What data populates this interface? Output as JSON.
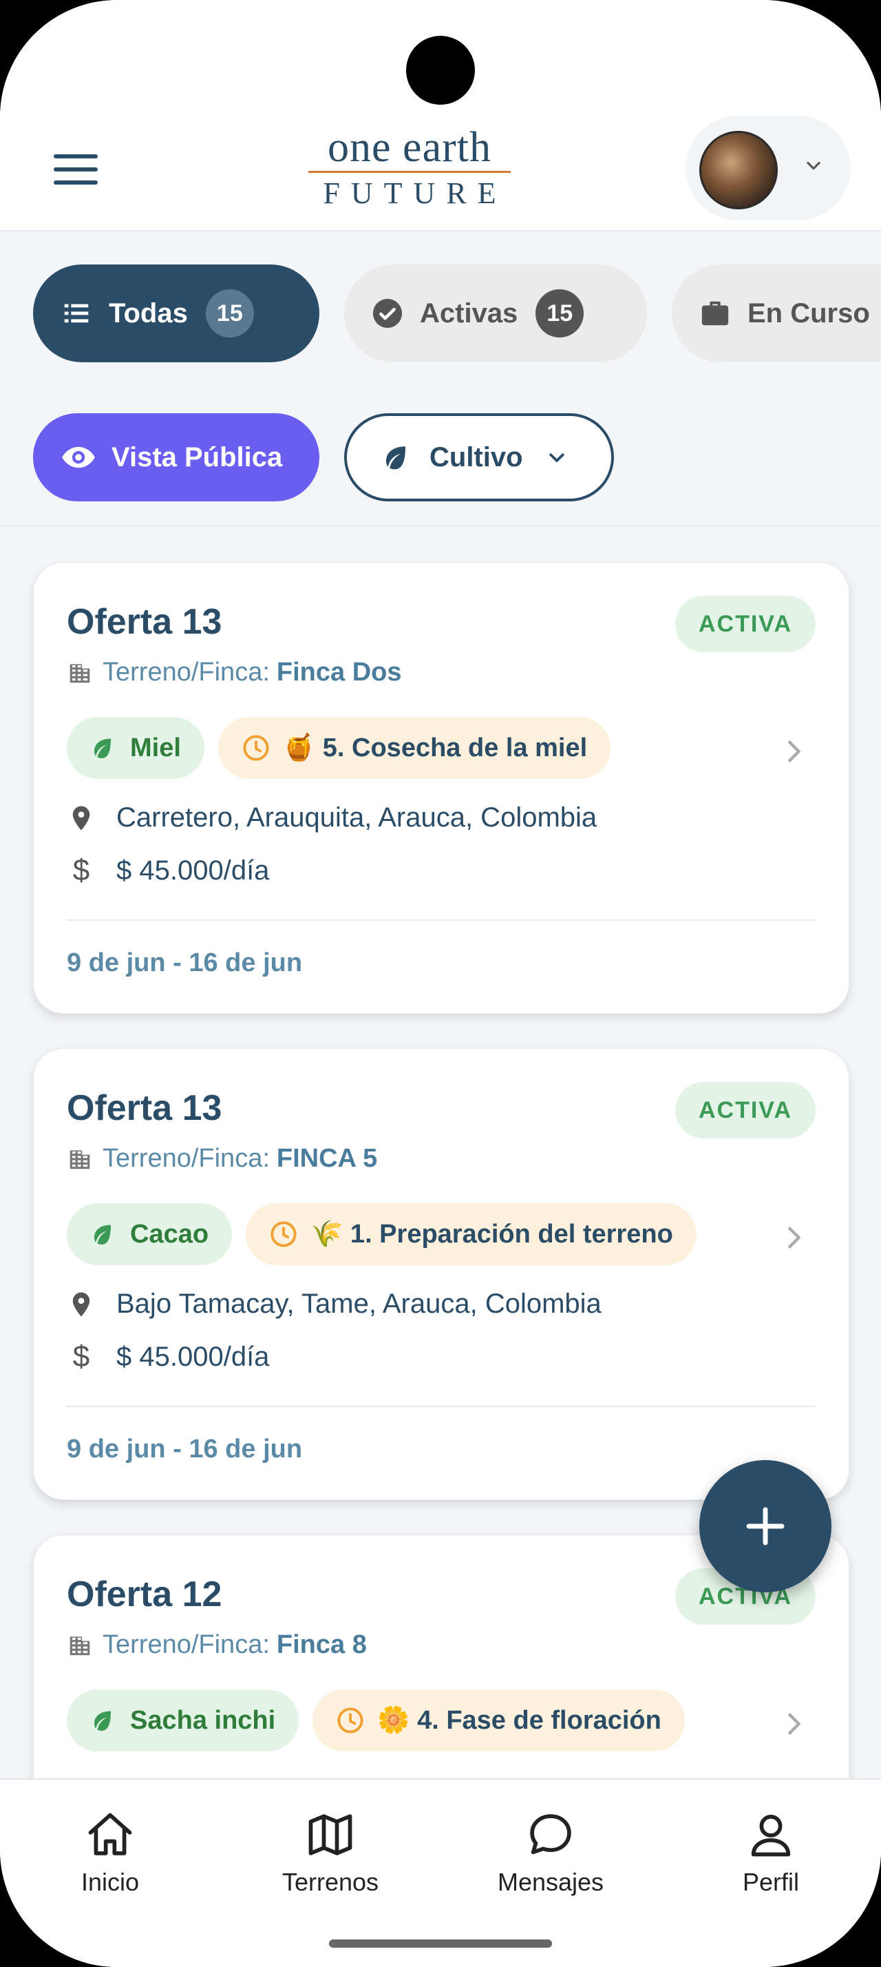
{
  "header": {
    "logo_top": "one earth",
    "logo_bottom": "FUTURE",
    "menu_icon": "hamburger-icon",
    "profile_chevron_icon": "chevron-down-icon"
  },
  "filters": {
    "tabs": [
      {
        "label": "Todas",
        "count": "15",
        "icon": "list-icon",
        "active": true
      },
      {
        "label": "Activas",
        "count": "15",
        "icon": "check-circle-icon",
        "active": false
      },
      {
        "label": "En Curso",
        "icon": "briefcase-icon",
        "active": false
      }
    ],
    "public_view_label": "Vista Pública",
    "crop_filter_label": "Cultivo"
  },
  "offers": [
    {
      "title": "Oferta 13",
      "status": "ACTIVA",
      "terreno_label": "Terreno/Finca:",
      "terreno_name": "Finca Dos",
      "crop": "Miel",
      "stage": "🍯 5. Cosecha de la miel",
      "location": "Carretero, Arauquita, Arauca, Colombia",
      "price": "$ 45.000/día",
      "dates": "9 de jun - 16 de jun"
    },
    {
      "title": "Oferta 13",
      "status": "ACTIVA",
      "terreno_label": "Terreno/Finca:",
      "terreno_name": "FINCA 5",
      "crop": "Cacao",
      "stage": "🌾 1. Preparación del terreno",
      "location": "Bajo Tamacay, Tame, Arauca, Colombia",
      "price": "$ 45.000/día",
      "dates": "9 de jun - 16 de jun"
    },
    {
      "title": "Oferta 12",
      "status": "ACTIVA",
      "terreno_label": "Terreno/Finca:",
      "terreno_name": "Finca 8",
      "crop": "Sacha inchi",
      "stage": "🌼 4. Fase de floración"
    }
  ],
  "bottom_nav": [
    {
      "label": "Inicio",
      "icon": "home-icon"
    },
    {
      "label": "Terrenos",
      "icon": "map-icon"
    },
    {
      "label": "Mensajes",
      "icon": "chat-icon"
    },
    {
      "label": "Perfil",
      "icon": "user-icon"
    }
  ],
  "colors": {
    "primary": "#2b4c66",
    "accent_purple": "#6a5df2",
    "active_green": "#3a9a56",
    "stage_bg": "#fdf0dc"
  }
}
